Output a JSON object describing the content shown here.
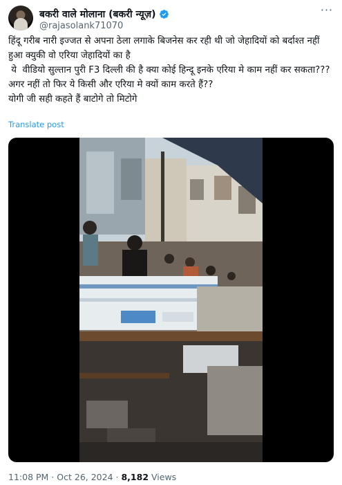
{
  "author": {
    "display_name": "बकरी वाले मोलाना (बकरी न्यूज़)",
    "handle": "@rajasolank71070",
    "verified": true
  },
  "tweet": {
    "text": "हिंदू गरीब नारी इज्जत से अपना ठेला लगाके बिजनेस कर रही थी जो जेहादियों को बर्दाश्त नहीं हुआ क्युकी वो एरिया जेहादियों का है\n ये  वीडियो सुल्तान पुरी F3 दिल्ली की है क्या कोई हिन्दू इनके एरिया मे काम नहीं कर सकता???\nअगर नहीं तो फिर ये किसी और एरिया मे क्यों काम करते हैं??\nयोगी जी सही कहते हैं बाटोगे तो मिटोगे",
    "translate_label": "Translate post"
  },
  "meta": {
    "time": "11:08 PM",
    "date": "Oct 26, 2024",
    "separator": "·",
    "views_count": "8,182",
    "views_label": "Views"
  },
  "colors": {
    "accent": "#1d9bf0",
    "text_primary": "#0f1419",
    "text_secondary": "#536471"
  },
  "icons": {
    "verified": "verified-badge-icon",
    "more": "more-options-icon"
  }
}
